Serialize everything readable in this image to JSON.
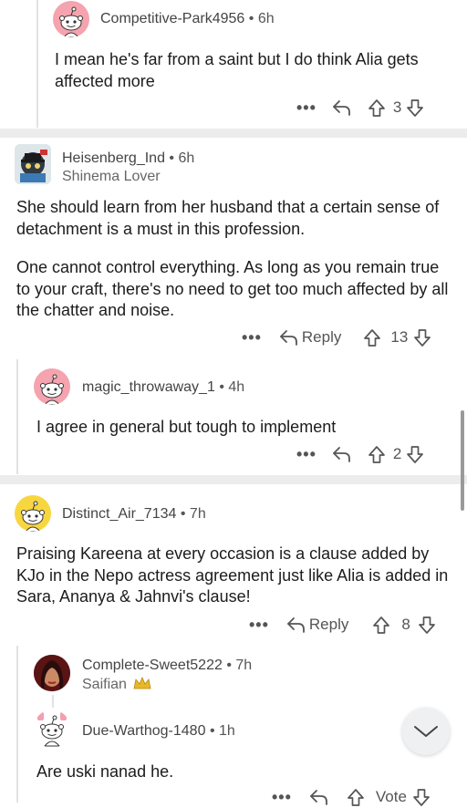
{
  "comments": [
    {
      "user": "Competitive-Park4956",
      "age": "6h",
      "body": "I mean he's far from a saint but I do think Alia gets affected more",
      "votes": "3"
    },
    {
      "user": "Heisenberg_Ind",
      "age": "6h",
      "flair": "Shinema Lover",
      "body1": "She should learn from her husband that a certain sense of detachment is a must in this profession.",
      "body2": "One cannot control everything. As long as you remain true to your craft, there's no need to get too much affected by all the chatter and noise.",
      "reply": "Reply",
      "votes": "13"
    },
    {
      "user": "magic_throwaway_1",
      "age": "4h",
      "body": "I agree in general but tough to implement",
      "votes": "2"
    },
    {
      "user": "Distinct_Air_7134",
      "age": "7h",
      "body": "Praising Kareena at every occasion is a clause added by KJo in the Nepo actress agreement just like Alia is added in Sara, Ananya & Jahnvi's clause!",
      "reply": "Reply",
      "votes": "8"
    },
    {
      "user": "Complete-Sweet5222",
      "age": "7h",
      "flair": "Saifian"
    },
    {
      "user": "Due-Warthog-1480",
      "age": "1h",
      "body": "Are uski nanad he.",
      "vote_label": "Vote"
    }
  ],
  "separator": "•",
  "more": "•••",
  "icons": [
    "reddit-snoo-avatar",
    "reply-arrow-icon",
    "upvote-icon",
    "downvote-icon",
    "chevron-down-icon"
  ],
  "colors": {
    "avatar_pink": "#f5a3ae",
    "avatar_yellow": "#f8d640",
    "text": "#1c1c1c",
    "meta": "#555555",
    "separator_band": "#ececec"
  }
}
